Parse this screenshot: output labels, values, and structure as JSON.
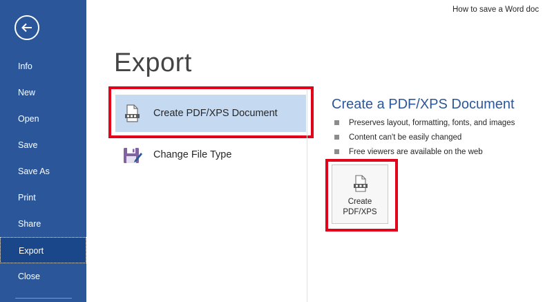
{
  "window": {
    "title": "How to save a Word doc"
  },
  "sidebar": {
    "back_icon": "arrow-left-icon",
    "items": [
      {
        "label": "Info"
      },
      {
        "label": "New"
      },
      {
        "label": "Open"
      },
      {
        "label": "Save"
      },
      {
        "label": "Save As"
      },
      {
        "label": "Print"
      },
      {
        "label": "Share"
      },
      {
        "label": "Export",
        "active": true
      },
      {
        "label": "Close"
      }
    ]
  },
  "main": {
    "title": "Export",
    "options": [
      {
        "label": "Create PDF/XPS Document",
        "icon": "pdf-document-icon",
        "selected": true
      },
      {
        "label": "Change File Type",
        "icon": "save-as-file-type-icon",
        "selected": false
      }
    ]
  },
  "detail": {
    "title": "Create a PDF/XPS Document",
    "bullets": [
      "Preserves layout, formatting, fonts, and images",
      "Content can't be easily changed",
      "Free viewers are available on the web"
    ],
    "button": {
      "line1": "Create",
      "line2": "PDF/XPS",
      "icon": "pdf-document-icon"
    }
  },
  "colors": {
    "sidebar": "#2b579a",
    "sidebar_active": "#19478a",
    "selected_option": "#c5d9f1",
    "accent_text": "#2b579a",
    "highlight_box": "#e3001b"
  }
}
